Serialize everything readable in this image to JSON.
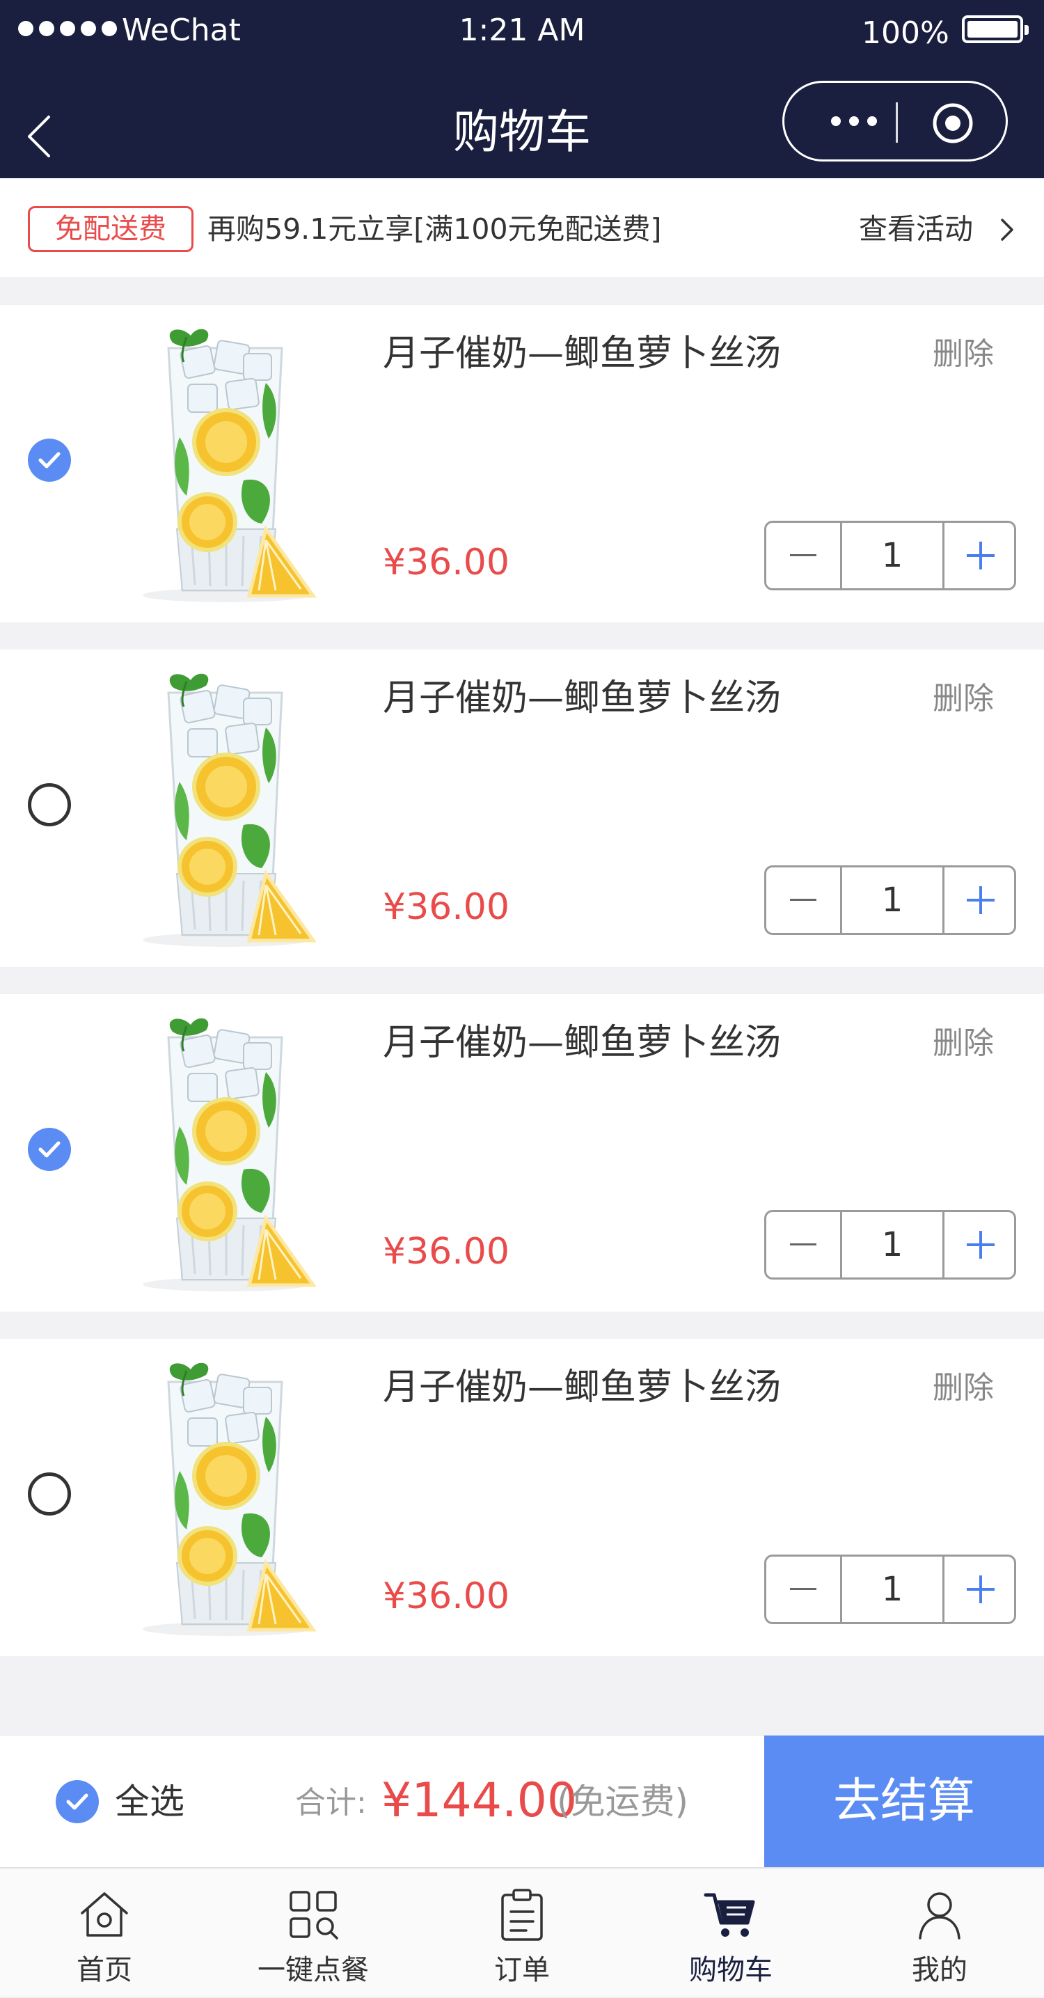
{
  "status_bar": {
    "carrier": "WeChat",
    "time": "1:21 AM",
    "battery": "100%"
  },
  "nav": {
    "title": "购物车"
  },
  "promo": {
    "badge": "免配送费",
    "text": "再购59.1元立享[满100元免配送费]",
    "link": "查看活动"
  },
  "items": [
    {
      "name": "月子催奶—鲫鱼萝卜丝汤",
      "price": "¥36.00",
      "quantity": "1",
      "checked": true,
      "delete_label": "删除"
    },
    {
      "name": "月子催奶—鲫鱼萝卜丝汤",
      "price": "¥36.00",
      "quantity": "1",
      "checked": false,
      "delete_label": "删除"
    },
    {
      "name": "月子催奶—鲫鱼萝卜丝汤",
      "price": "¥36.00",
      "quantity": "1",
      "checked": true,
      "delete_label": "删除"
    },
    {
      "name": "月子催奶—鲫鱼萝卜丝汤",
      "price": "¥36.00",
      "quantity": "1",
      "checked": false,
      "delete_label": "删除"
    }
  ],
  "checkout": {
    "select_all_label": "全选",
    "select_all_checked": true,
    "total_label": "合计:",
    "total_value": "¥144.00",
    "shipping_note": "(免运费)",
    "button_label": "去结算"
  },
  "tabbar": {
    "tabs": [
      {
        "label": "首页",
        "icon": "home-icon"
      },
      {
        "label": "一键点餐",
        "icon": "grid-search-icon"
      },
      {
        "label": "订单",
        "icon": "clipboard-icon"
      },
      {
        "label": "购物车",
        "icon": "cart-icon",
        "active": true
      },
      {
        "label": "我的",
        "icon": "user-icon"
      }
    ]
  },
  "colors": {
    "header_bg": "#1a1f3f",
    "accent_blue": "#5b8cf3",
    "price_red": "#e94b4b"
  }
}
